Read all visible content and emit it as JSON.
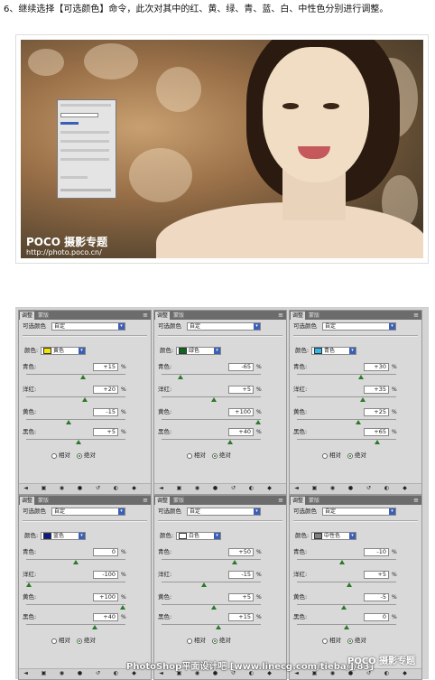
{
  "instruction": "6、继续选择【可选颜色】命令，此次对其中的红、黄、绿、青、蓝、白、中性色分别进行调整。",
  "photo": {
    "watermark_brand": "POCO 摄影专题",
    "watermark_url": "http://photo.poco.cn/"
  },
  "panels": [
    {
      "tab_adjust": "调整",
      "tab_mask": "蒙版",
      "preset_label": "可选颜色",
      "preset_value": "自定",
      "color_label": "颜色:",
      "color_name": "黄色",
      "swatch": "#f2e600",
      "rows": [
        {
          "label": "青色:",
          "value": "+15"
        },
        {
          "label": "洋红:",
          "value": "+20"
        },
        {
          "label": "黄色:",
          "value": "-15"
        },
        {
          "label": "黑色:",
          "value": "+5"
        }
      ],
      "radio_relative": "相对",
      "radio_absolute": "绝对",
      "pct": "%"
    },
    {
      "tab_adjust": "调整",
      "tab_mask": "蒙版",
      "preset_label": "可选颜色",
      "preset_value": "自定",
      "color_label": "颜色:",
      "color_name": "绿色",
      "swatch": "#0a6a1a",
      "rows": [
        {
          "label": "青色:",
          "value": "-65"
        },
        {
          "label": "洋红:",
          "value": "+5"
        },
        {
          "label": "黄色:",
          "value": "+100"
        },
        {
          "label": "黑色:",
          "value": "+40"
        }
      ],
      "radio_relative": "相对",
      "radio_absolute": "绝对",
      "pct": "%"
    },
    {
      "tab_adjust": "调整",
      "tab_mask": "蒙版",
      "preset_label": "可选颜色",
      "preset_value": "自定",
      "color_label": "颜色:",
      "color_name": "青色",
      "swatch": "#32b8e8",
      "rows": [
        {
          "label": "青色:",
          "value": "+30"
        },
        {
          "label": "洋红:",
          "value": "+35"
        },
        {
          "label": "黄色:",
          "value": "+25"
        },
        {
          "label": "黑色:",
          "value": "+65"
        }
      ],
      "radio_relative": "相对",
      "radio_absolute": "绝对",
      "pct": "%"
    },
    {
      "tab_adjust": "调整",
      "tab_mask": "蒙版",
      "preset_label": "可选颜色",
      "preset_value": "自定",
      "color_label": "颜色:",
      "color_name": "蓝色",
      "swatch": "#0a1a8a",
      "rows": [
        {
          "label": "青色:",
          "value": "0"
        },
        {
          "label": "洋红:",
          "value": "-100"
        },
        {
          "label": "黄色:",
          "value": "+100"
        },
        {
          "label": "黑色:",
          "value": "+40"
        }
      ],
      "radio_relative": "相对",
      "radio_absolute": "绝对",
      "pct": "%"
    },
    {
      "tab_adjust": "调整",
      "tab_mask": "蒙版",
      "preset_label": "可选颜色",
      "preset_value": "自定",
      "color_label": "颜色:",
      "color_name": "白色",
      "swatch": "#ffffff",
      "rows": [
        {
          "label": "青色:",
          "value": "+50"
        },
        {
          "label": "洋红:",
          "value": "-15"
        },
        {
          "label": "黄色:",
          "value": "+5"
        },
        {
          "label": "黑色:",
          "value": "+15"
        }
      ],
      "radio_relative": "相对",
      "radio_absolute": "绝对",
      "pct": "%"
    },
    {
      "tab_adjust": "调整",
      "tab_mask": "蒙版",
      "preset_label": "可选颜色",
      "preset_value": "自定",
      "color_label": "颜色:",
      "color_name": "中性色",
      "swatch": "#808080",
      "rows": [
        {
          "label": "青色:",
          "value": "-10"
        },
        {
          "label": "洋红:",
          "value": "+5"
        },
        {
          "label": "黄色:",
          "value": "-5"
        },
        {
          "label": "黑色:",
          "value": "0"
        }
      ],
      "radio_relative": "相对",
      "radio_absolute": "绝对",
      "pct": "%"
    }
  ],
  "credit": "PhotoShop平面设计吧 [www.linecg.com/tieba/]/83]",
  "poco_mark": "POCO 摄影专题"
}
